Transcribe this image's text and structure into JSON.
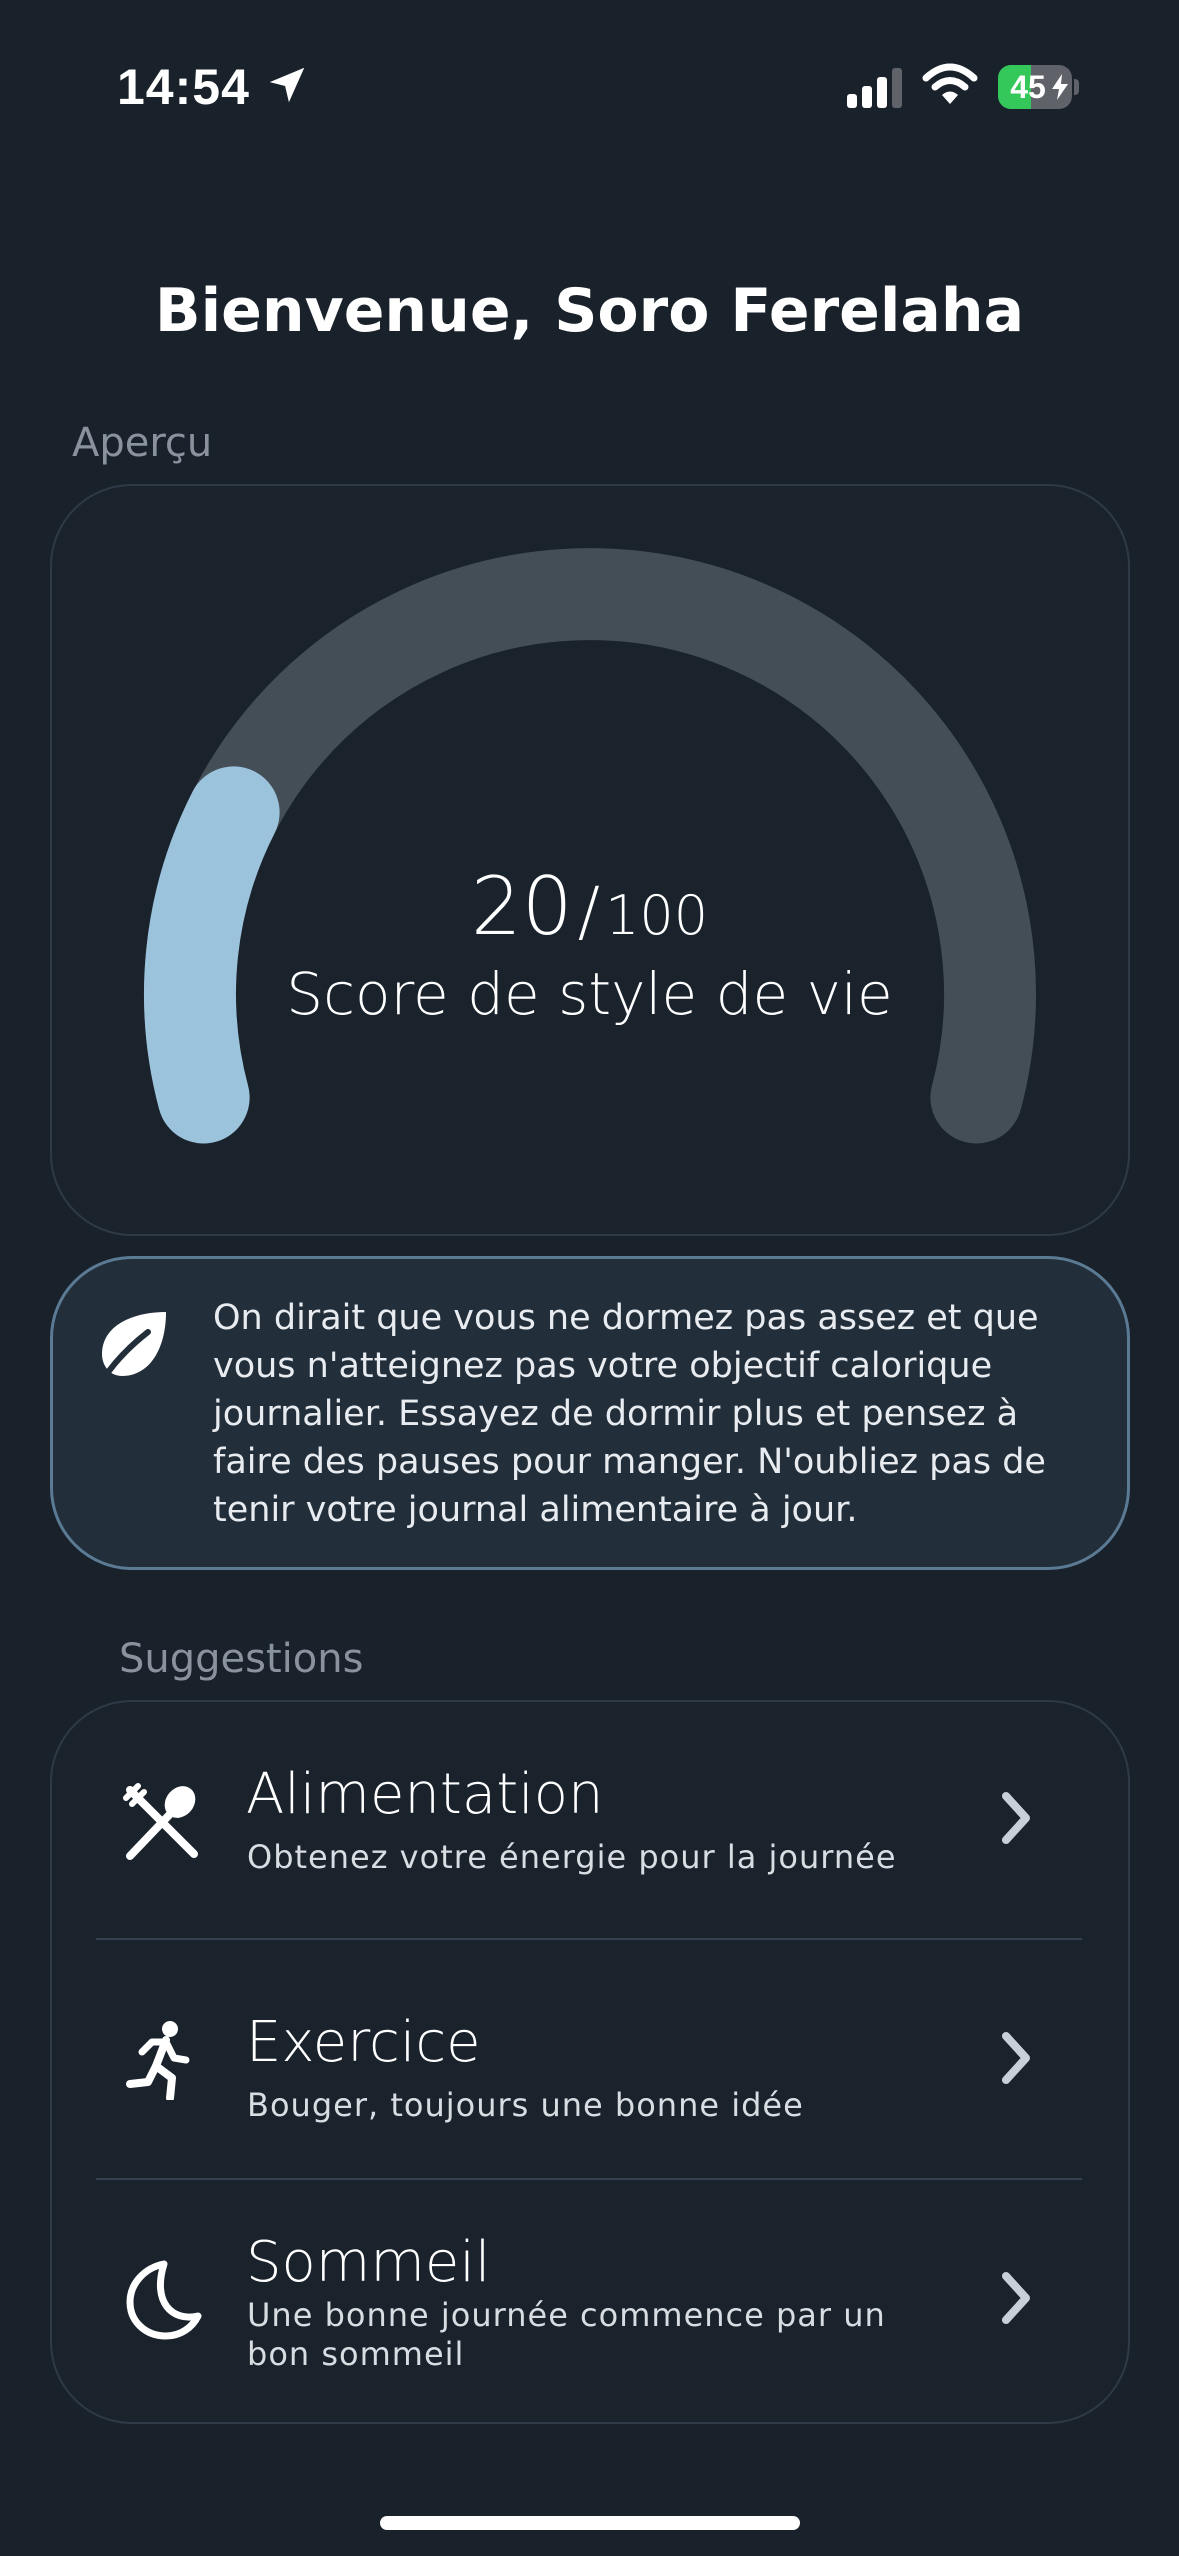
{
  "status_bar": {
    "time": "14:54",
    "battery_text": "45",
    "battery_level": 0.45,
    "icons": [
      "location-arrow-icon",
      "cellular-signal-icon",
      "wifi-icon",
      "battery-charging-icon"
    ]
  },
  "header": {
    "welcome": "Bienvenue, Soro Ferelaha"
  },
  "overview": {
    "label": "Aperçu",
    "score_value": "20",
    "score_separator": "/",
    "score_max": "100",
    "score_fraction": 0.2,
    "caption": "Score de style de vie"
  },
  "advice": {
    "icon": "leaf-icon",
    "text": "On dirait que vous ne dormez pas assez et que vous n'atteignez pas votre objectif calorique journalier. Essayez de dormir plus et pensez à faire des pauses pour manger. N'oubliez pas de tenir votre journal alimentaire à jour."
  },
  "suggestions": {
    "label": "Suggestions",
    "items": [
      {
        "icon": "fork-spoon-icon",
        "title": "Alimentation",
        "subtitle": "Obtenez votre énergie pour la journée"
      },
      {
        "icon": "running-person-icon",
        "title": "Exercice",
        "subtitle": "Bouger, toujours une bonne idée"
      },
      {
        "icon": "moon-icon",
        "title": "Sommeil",
        "subtitle": "Une bonne journée commence par un bon sommeil"
      }
    ]
  },
  "colors": {
    "background": "#19212b",
    "gauge_track": "#444e57",
    "gauge_fill": "#9cc3dc",
    "advice_border": "#5b7a94",
    "battery_green": "#34c759"
  }
}
